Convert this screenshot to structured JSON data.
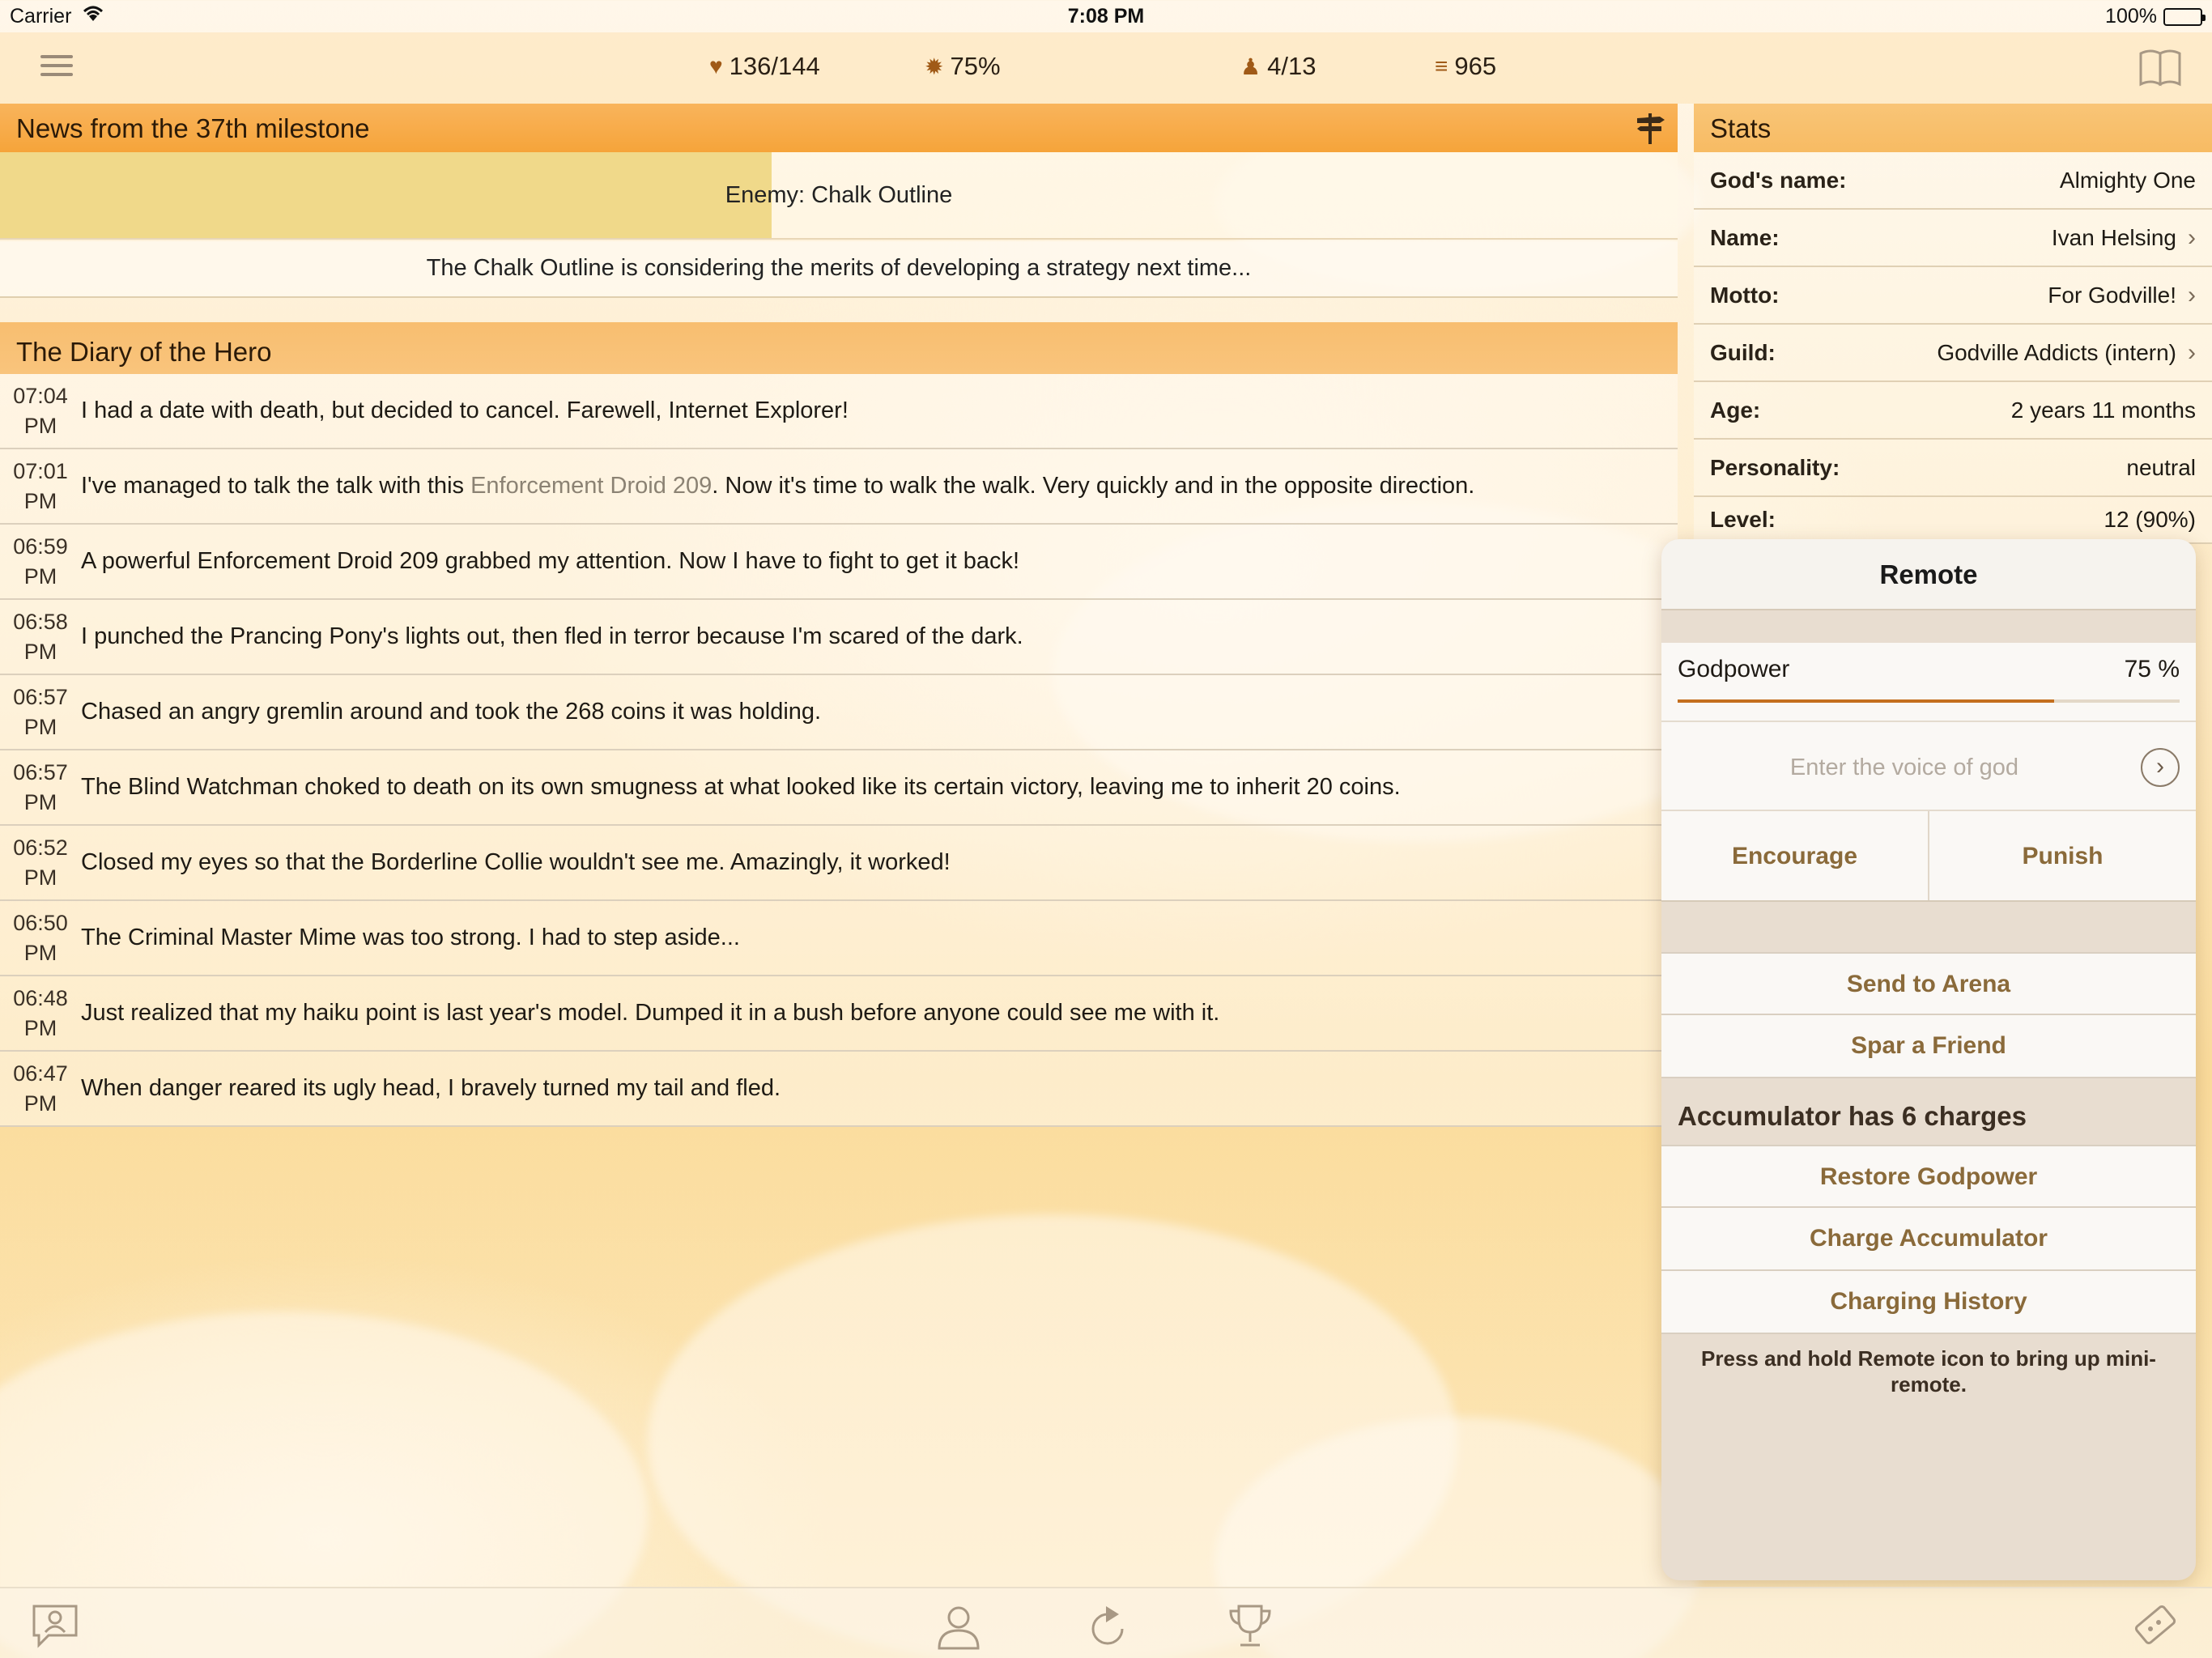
{
  "status_bar": {
    "carrier": "Carrier",
    "time": "7:08 PM",
    "battery": "100%"
  },
  "top_bar": {
    "health": "136/144",
    "godpower": "75%",
    "inventory": "4/13",
    "gold": "965"
  },
  "news": {
    "header": "News from the 37th milestone",
    "enemy": "Enemy: Chalk Outline",
    "enemy_health_fraction": 0.46,
    "message": "The Chalk Outline is considering the merits of developing a strategy next time..."
  },
  "diary": {
    "header": "The Diary of the Hero",
    "entries": [
      {
        "time": "07:04",
        "ampm": "PM",
        "text": "I had a date with death, but decided to cancel. Farewell, Internet Explorer!"
      },
      {
        "time": "07:01",
        "ampm": "PM",
        "pre": "I've managed to talk the talk with this ",
        "highlight": "Enforcement Droid 209",
        "post": ". Now it's time to walk the walk. Very quickly and in the opposite direction."
      },
      {
        "time": "06:59",
        "ampm": "PM",
        "text": "A powerful Enforcement Droid 209 grabbed my attention. Now I have to fight to get it back!"
      },
      {
        "time": "06:58",
        "ampm": "PM",
        "text": "I punched the Prancing Pony's lights out, then fled in terror because I'm scared of the dark."
      },
      {
        "time": "06:57",
        "ampm": "PM",
        "text": "Chased an angry gremlin around and took the 268 coins it was holding."
      },
      {
        "time": "06:57",
        "ampm": "PM",
        "text": "The Blind Watchman choked to death on its own smugness at what looked like its certain victory, leaving me to inherit 20 coins."
      },
      {
        "time": "06:52",
        "ampm": "PM",
        "text": "Closed my eyes so that the Borderline Collie wouldn't see me. Amazingly, it worked!"
      },
      {
        "time": "06:50",
        "ampm": "PM",
        "text": "The Criminal Master Mime was too strong. I had to step aside..."
      },
      {
        "time": "06:48",
        "ampm": "PM",
        "text": "Just realized that my haiku point is last year's model. Dumped it in a bush before anyone could see me with it."
      },
      {
        "time": "06:47",
        "ampm": "PM",
        "text": "When danger reared its ugly head, I bravely turned my tail and fled."
      }
    ]
  },
  "stats": {
    "header": "Stats",
    "rows": [
      {
        "key": "God's name:",
        "value": "Almighty One"
      },
      {
        "key": "Name:",
        "value": "Ivan Helsing"
      },
      {
        "key": "Motto:",
        "value": "For Godville!"
      },
      {
        "key": "Guild:",
        "value": "Godville Addicts (intern)"
      },
      {
        "key": "Age:",
        "value": "2 years 11 months"
      },
      {
        "key": "Personality:",
        "value": "neutral"
      },
      {
        "key": "Level:",
        "value": "12 (90%)"
      }
    ]
  },
  "remote": {
    "title": "Remote",
    "godpower_label": "Godpower",
    "godpower_value": "75 %",
    "godpower_fraction": 0.75,
    "voice_placeholder": "Enter the voice of god",
    "encourage": "Encourage",
    "punish": "Punish",
    "send_to_arena": "Send to Arena",
    "spar_a_friend": "Spar a Friend",
    "accumulator_title": "Accumulator has 6 charges",
    "restore_godpower": "Restore Godpower",
    "charge_accumulator": "Charge Accumulator",
    "charging_history": "Charging History",
    "hint": "Press and hold Remote icon to bring up mini-remote."
  },
  "colors": {
    "header_orange": "#f6a43a",
    "button_text": "#8a6a3a",
    "godpower_bar": "#c46f1e"
  },
  "icons": [
    "wifi-icon",
    "menu-icon",
    "heart-icon",
    "sun-icon",
    "bag-icon",
    "coins-icon",
    "book-icon",
    "signpost-icon",
    "chat-icon",
    "hero-icon",
    "refresh-icon",
    "trophy-icon",
    "remote-icon"
  ]
}
